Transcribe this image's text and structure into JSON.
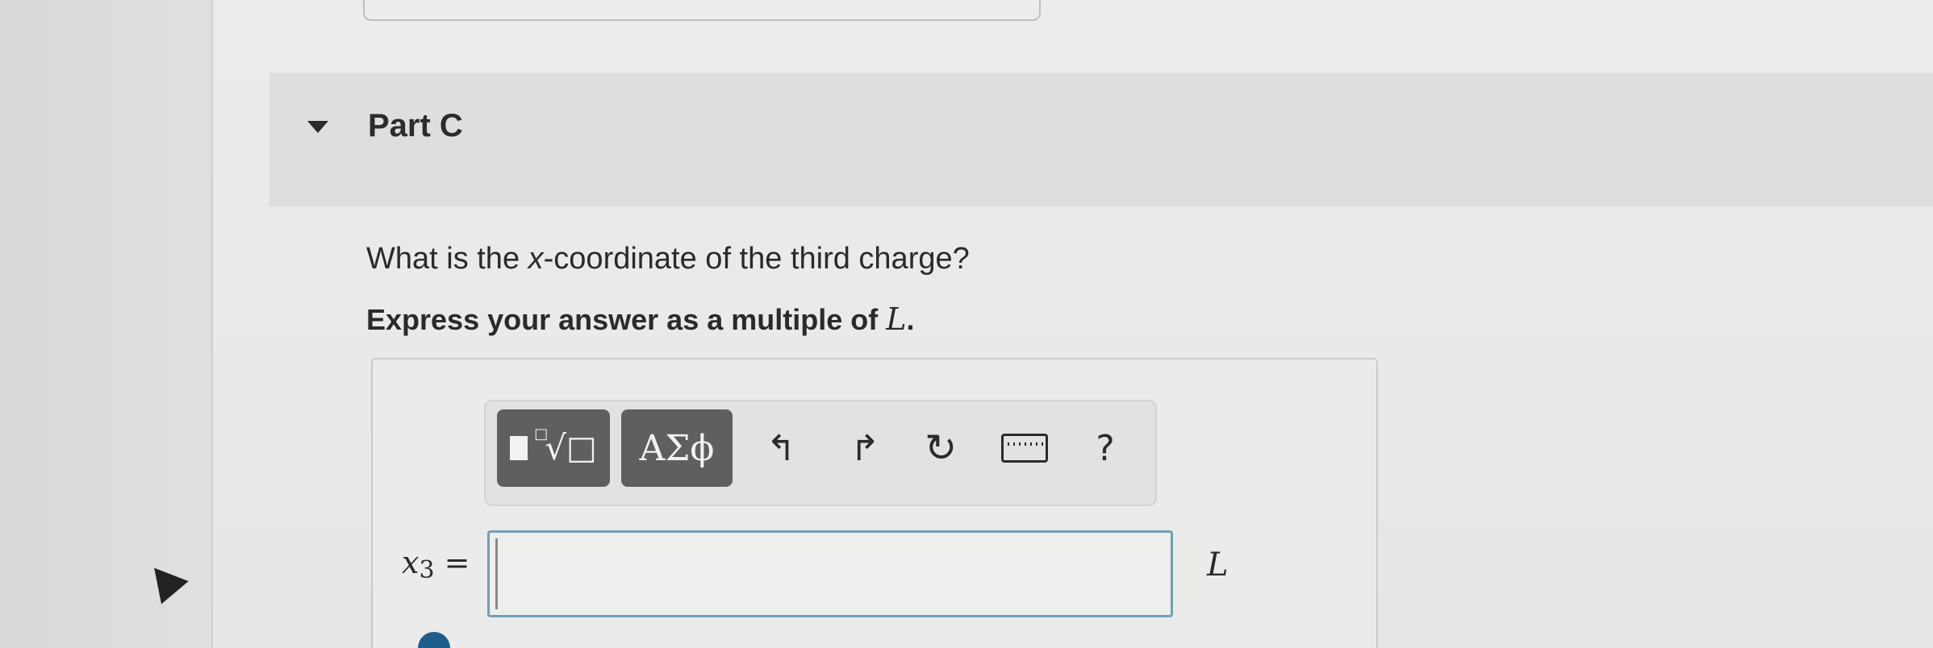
{
  "part": {
    "title": "Part C"
  },
  "question": {
    "prefix": "What is the ",
    "variable": "x",
    "suffix": "-coordinate of the third charge?"
  },
  "instruction": {
    "prefix": "Express your answer as a multiple of ",
    "variable": "L",
    "suffix": "."
  },
  "toolbar": {
    "templates_radical": "√",
    "templates_box": "□",
    "greek_label": "ΑΣϕ",
    "undo_glyph": "↰",
    "redo_glyph": "↱",
    "reset_glyph": "↻",
    "help_label": "?",
    "icons": [
      "templates-icon",
      "greek-symbols-icon",
      "undo-icon",
      "redo-icon",
      "reset-icon",
      "keyboard-icon",
      "help-icon"
    ]
  },
  "answer": {
    "variable": "x",
    "subscript": "3",
    "equals": " =",
    "value": "",
    "unit": "L"
  },
  "colors": {
    "input_border": "#6f9fb7",
    "toolbar_button": "#5f5f5f",
    "header_bg": "#dedede"
  }
}
